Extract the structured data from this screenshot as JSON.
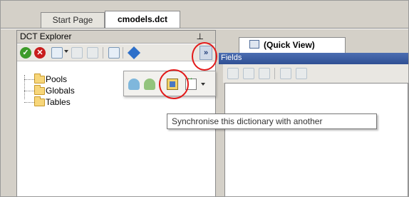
{
  "tabs": [
    {
      "label": "Start Page"
    },
    {
      "label": "cmodels.dct",
      "active": true
    }
  ],
  "explorer": {
    "title": "DCT Explorer",
    "pin_glyph": "I",
    "overflow_glyph": "»",
    "tree": [
      {
        "label": "Pools"
      },
      {
        "label": "Globals"
      },
      {
        "label": "Tables"
      }
    ]
  },
  "quick_view": {
    "tab_label": "(Quick View)",
    "fields_label": "Fields"
  },
  "tooltip": {
    "text": "Synchronise this dictionary with another"
  },
  "colors": {
    "highlight_circle": "#e21a1a",
    "fields_bar": "#3b5ea5",
    "ok": "#3d9b2a",
    "error": "#c81d1d"
  },
  "icons": [
    "check-icon",
    "close-icon",
    "users-icon",
    "sync-icon",
    "pin-icon"
  ]
}
